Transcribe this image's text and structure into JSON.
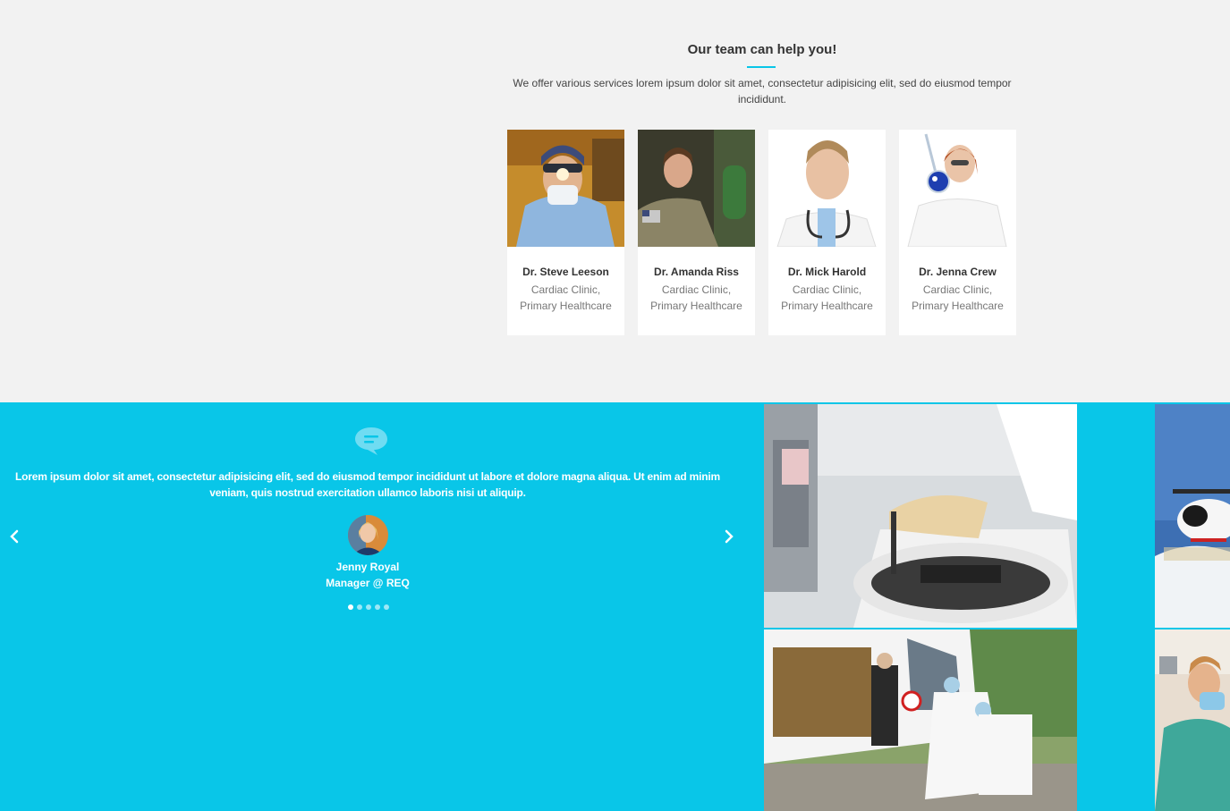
{
  "team": {
    "title": "Our team can help you!",
    "description": "We offer various services lorem ipsum dolor sit amet, consectetur adipisicing elit, sed do eiusmod tempor incididunt.",
    "members": [
      {
        "name": "Dr. Steve Leeson",
        "role_line1": "Cardiac Clinic,",
        "role_line2": "Primary Healthcare",
        "photo": "surgeon-photo"
      },
      {
        "name": "Dr. Amanda Riss",
        "role_line1": "Cardiac Clinic,",
        "role_line2": "Primary Healthcare",
        "photo": "military-medic-photo"
      },
      {
        "name": "Dr. Mick Harold",
        "role_line1": "Cardiac Clinic,",
        "role_line2": "Primary Healthcare",
        "photo": "doctor-stethoscope-photo"
      },
      {
        "name": "Dr. Jenna Crew",
        "role_line1": "Cardiac Clinic,",
        "role_line2": "Primary Healthcare",
        "photo": "lab-scientist-photo"
      }
    ]
  },
  "testimonial": {
    "quote_icon": "chat-bubble-icon",
    "text": "Lorem ipsum dolor sit amet, consectetur adipisicing elit, sed do eiusmod tempor incididunt ut labore et dolore magna aliqua. Ut enim ad minim veniam, quis nostrud exercitation ullamco laboris nisi ut aliquip.",
    "person_name": "Jenny Royal",
    "person_title": "Manager @ REQ",
    "prev_icon": "chevron-left-icon",
    "next_icon": "chevron-right-icon",
    "slide_count": 5,
    "active_slide": 1
  },
  "gallery": {
    "images": [
      "lab-centrifuge-photo",
      "helicopter-rescue-photo",
      "ambulance-emergency-photo",
      "dental-surgery-photo"
    ]
  },
  "colors": {
    "accent": "#09c6e8",
    "background": "#f2f2f2"
  }
}
